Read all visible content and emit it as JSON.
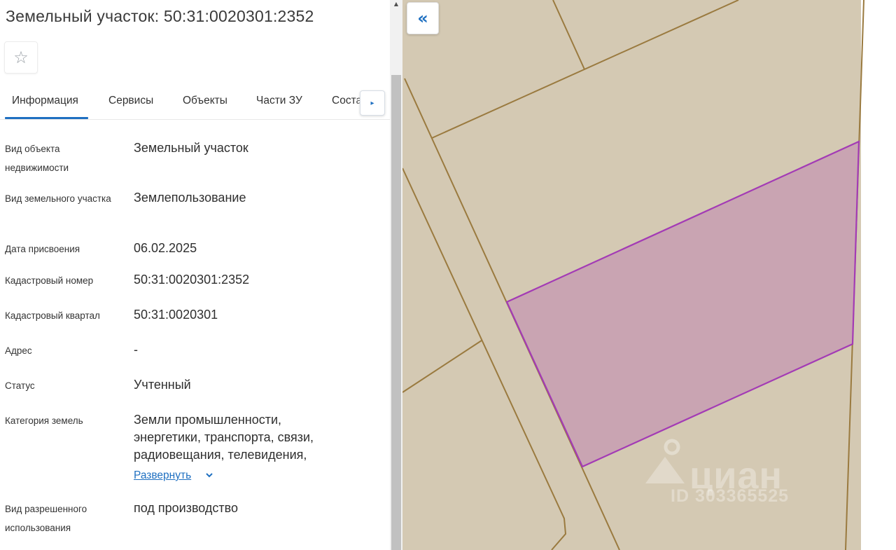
{
  "panel": {
    "title": "Земельный участок: 50:31:0020301:2352",
    "favorite_icon": "☆",
    "tabs": [
      {
        "label": "Информация",
        "active": true
      },
      {
        "label": "Сервисы",
        "active": false
      },
      {
        "label": "Объекты",
        "active": false
      },
      {
        "label": "Части ЗУ",
        "active": false
      },
      {
        "label": "Соста",
        "active": false
      }
    ],
    "tabs_next_icon": "▸",
    "fields": [
      {
        "label": "Вид объекта недвижимости",
        "value": "Земельный участок"
      },
      {
        "label": "Вид земельного участка",
        "value": "Землепользование"
      },
      {
        "label": "Дата присвоения",
        "value": "06.02.2025"
      },
      {
        "label": "Кадастровый номер",
        "value": "50:31:0020301:2352"
      },
      {
        "label": "Кадастровый квартал",
        "value": "50:31:0020301"
      },
      {
        "label": "Адрес",
        "value": "-"
      },
      {
        "label": "Статус",
        "value": "Учтенный"
      },
      {
        "label": "Категория земель",
        "value": "Земли промышленности, энергетики, транспорта, связи, радиовещания, телевидения,"
      },
      {
        "label": "Вид разрешенного использования",
        "value": "под производство"
      }
    ],
    "expand_label": "Развернуть"
  },
  "map": {
    "collapse_icon": "«",
    "watermark_brand": "циан",
    "watermark_id": "ID 303365525",
    "colors": {
      "background": "#d4c9b3",
      "boundary": "#9a7a3f",
      "selected_fill": "#c9a4b2",
      "selected_stroke": "#a33bb5"
    }
  },
  "colors": {
    "accent": "#1f70c1",
    "scrollbar_thumb": "#c1c1c1"
  }
}
